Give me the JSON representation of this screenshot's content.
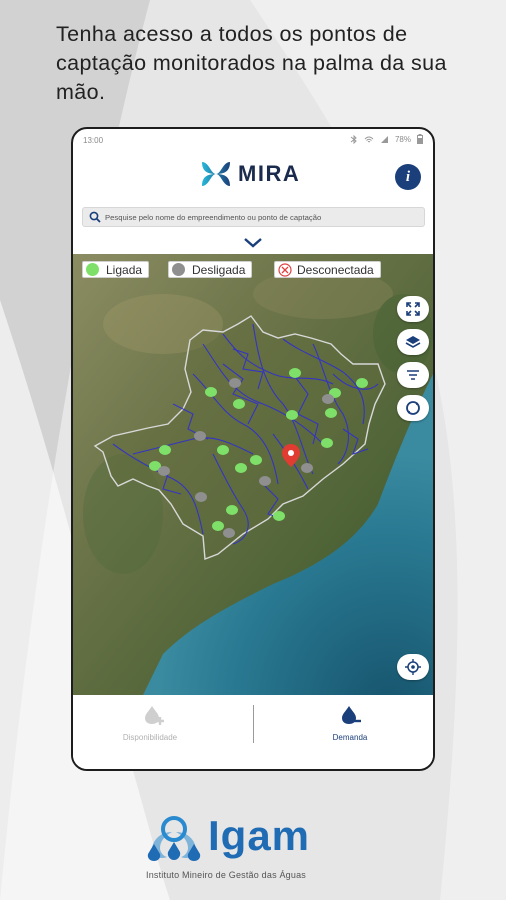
{
  "headline": "Tenha acesso a todos os pontos de captação monitorados na palma da sua mão.",
  "statusbar": {
    "time": "13:00",
    "battery": "78%"
  },
  "app": {
    "brand": "MIRA",
    "info_label": "i"
  },
  "search": {
    "placeholder": "Pesquise pelo nome do empreendimento ou ponto de captação"
  },
  "legend": [
    {
      "label": "Ligada",
      "color": "#7ee069"
    },
    {
      "label": "Desligada",
      "color": "#8f8f8f"
    },
    {
      "label": "Desconectada",
      "color": "#e04040"
    }
  ],
  "map_controls": [
    "fullscreen-icon",
    "layers-icon",
    "filter-icon",
    "refresh-icon",
    "locate-icon"
  ],
  "bottom_nav": {
    "disponibilidade": "Disponibilidade",
    "demanda": "Demanda"
  },
  "colors": {
    "accent": "#1b3f7a",
    "brand_blue": "#1f6bb4",
    "river": "#2f2fd0"
  },
  "logo": {
    "name": "Igam",
    "subtitle": "Instituto Mineiro de Gestão das Águas"
  }
}
